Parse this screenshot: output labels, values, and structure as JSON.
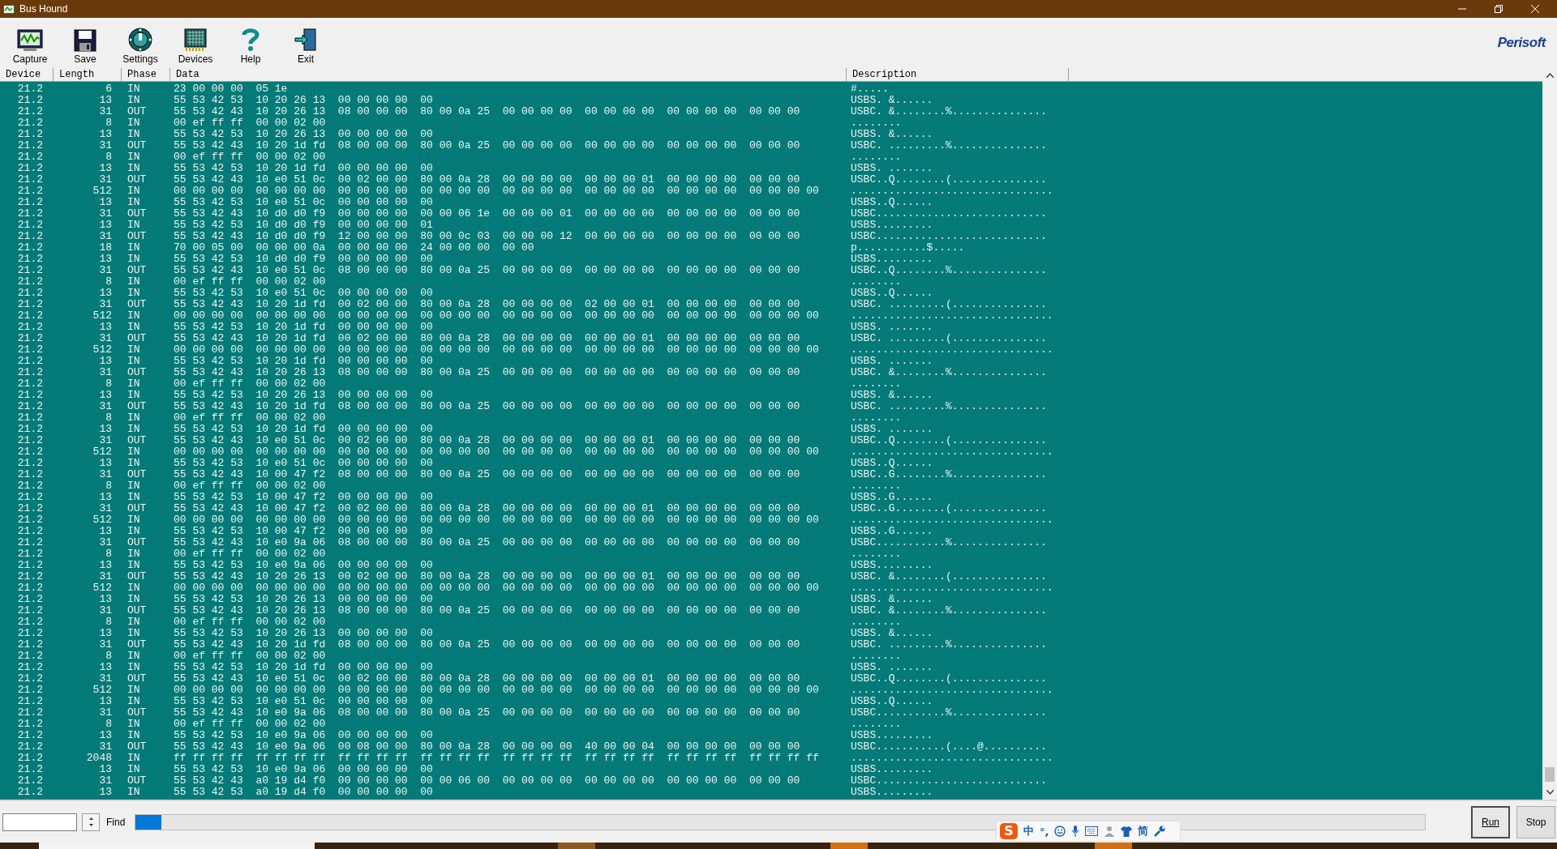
{
  "window": {
    "title": "Bus Hound"
  },
  "toolbar": {
    "buttons": [
      {
        "label": "Capture",
        "kind": "capture"
      },
      {
        "label": "Save",
        "kind": "save"
      },
      {
        "label": "Settings",
        "kind": "settings"
      },
      {
        "label": "Devices",
        "kind": "devices"
      },
      {
        "label": "Help",
        "kind": "help"
      },
      {
        "label": "Exit",
        "kind": "exit"
      }
    ],
    "logo": "Perisoft"
  },
  "columns": [
    "Device",
    "Length",
    "Phase",
    "Data",
    "Description"
  ],
  "rows": [
    {
      "device": "21.2",
      "length": "6",
      "phase": "IN",
      "data": "23 00 00 00  05 1e",
      "description": "#....."
    },
    {
      "device": "21.2",
      "length": "13",
      "phase": "IN",
      "data": "55 53 42 53  10 20 26 13  00 00 00 00  00",
      "description": "USBS. &......"
    },
    {
      "device": "21.2",
      "length": "31",
      "phase": "OUT",
      "data": "55 53 42 43  10 20 26 13  08 00 00 00  80 00 0a 25  00 00 00 00  00 00 00 00  00 00 00 00  00 00 00",
      "description": "USBC. &........%..............."
    },
    {
      "device": "21.2",
      "length": "8",
      "phase": "IN",
      "data": "00 ef ff ff  00 00 02 00",
      "description": "........"
    },
    {
      "device": "21.2",
      "length": "13",
      "phase": "IN",
      "data": "55 53 42 53  10 20 26 13  00 00 00 00  00",
      "description": "USBS. &......"
    },
    {
      "device": "21.2",
      "length": "31",
      "phase": "OUT",
      "data": "55 53 42 43  10 20 1d fd  08 00 00 00  80 00 0a 25  00 00 00 00  00 00 00 00  00 00 00 00  00 00 00",
      "description": "USBC. .........%..............."
    },
    {
      "device": "21.2",
      "length": "8",
      "phase": "IN",
      "data": "00 ef ff ff  00 00 02 00",
      "description": "........"
    },
    {
      "device": "21.2",
      "length": "13",
      "phase": "IN",
      "data": "55 53 42 53  10 20 1d fd  00 00 00 00  00",
      "description": "USBS. ......."
    },
    {
      "device": "21.2",
      "length": "31",
      "phase": "OUT",
      "data": "55 53 42 43  10 e0 51 0c  00 02 00 00  80 00 0a 28  00 00 00 00  00 00 00 01  00 00 00 00  00 00 00",
      "description": "USBC..Q........(..............."
    },
    {
      "device": "21.2",
      "length": "512",
      "phase": "IN",
      "data": "00 00 00 00  00 00 00 00  00 00 00 00  00 00 00 00  00 00 00 00  00 00 00 00  00 00 00 00  00 00 00 00",
      "description": "................................"
    },
    {
      "device": "21.2",
      "length": "13",
      "phase": "IN",
      "data": "55 53 42 53  10 e0 51 0c  00 00 00 00  00",
      "description": "USBS..Q......"
    },
    {
      "device": "21.2",
      "length": "31",
      "phase": "OUT",
      "data": "55 53 42 43  10 d0 d0 f9  00 00 00 00  00 00 06 1e  00 00 00 01  00 00 00 00  00 00 00 00  00 00 00",
      "description": "USBC..........................."
    },
    {
      "device": "21.2",
      "length": "13",
      "phase": "IN",
      "data": "55 53 42 53  10 d0 d0 f9  00 00 00 00  01",
      "description": "USBS........."
    },
    {
      "device": "21.2",
      "length": "31",
      "phase": "OUT",
      "data": "55 53 42 43  10 d0 d0 f9  12 00 00 00  80 00 0c 03  00 00 00 12  00 00 00 00  00 00 00 00  00 00 00",
      "description": "USBC..........................."
    },
    {
      "device": "21.2",
      "length": "18",
      "phase": "IN",
      "data": "70 00 05 00  00 00 00 0a  00 00 00 00  24 00 00 00  00 00",
      "description": "p...........$....."
    },
    {
      "device": "21.2",
      "length": "13",
      "phase": "IN",
      "data": "55 53 42 53  10 d0 d0 f9  00 00 00 00  00",
      "description": "USBS........."
    },
    {
      "device": "21.2",
      "length": "31",
      "phase": "OUT",
      "data": "55 53 42 43  10 e0 51 0c  08 00 00 00  80 00 0a 25  00 00 00 00  00 00 00 00  00 00 00 00  00 00 00",
      "description": "USBC..Q........%..............."
    },
    {
      "device": "21.2",
      "length": "8",
      "phase": "IN",
      "data": "00 ef ff ff  00 00 02 00",
      "description": "........"
    },
    {
      "device": "21.2",
      "length": "13",
      "phase": "IN",
      "data": "55 53 42 53  10 e0 51 0c  00 00 00 00  00",
      "description": "USBS..Q......"
    },
    {
      "device": "21.2",
      "length": "31",
      "phase": "OUT",
      "data": "55 53 42 43  10 20 1d fd  00 02 00 00  80 00 0a 28  00 00 00 00  02 00 00 01  00 00 00 00  00 00 00",
      "description": "USBC. .........(..............."
    },
    {
      "device": "21.2",
      "length": "512",
      "phase": "IN",
      "data": "00 00 00 00  00 00 00 00  00 00 00 00  00 00 00 00  00 00 00 00  00 00 00 00  00 00 00 00  00 00 00 00",
      "description": "................................"
    },
    {
      "device": "21.2",
      "length": "13",
      "phase": "IN",
      "data": "55 53 42 53  10 20 1d fd  00 00 00 00  00",
      "description": "USBS. ......."
    },
    {
      "device": "21.2",
      "length": "31",
      "phase": "OUT",
      "data": "55 53 42 43  10 20 1d fd  00 02 00 00  80 00 0a 28  00 00 00 00  00 00 00 01  00 00 00 00  00 00 00",
      "description": "USBC. .........(..............."
    },
    {
      "device": "21.2",
      "length": "512",
      "phase": "IN",
      "data": "00 00 00 00  00 00 00 00  00 00 00 00  00 00 00 00  00 00 00 00  00 00 00 00  00 00 00 00  00 00 00 00",
      "description": "................................"
    },
    {
      "device": "21.2",
      "length": "13",
      "phase": "IN",
      "data": "55 53 42 53  10 20 1d fd  00 00 00 00  00",
      "description": "USBS. ......."
    },
    {
      "device": "21.2",
      "length": "31",
      "phase": "OUT",
      "data": "55 53 42 43  10 20 26 13  08 00 00 00  80 00 0a 25  00 00 00 00  00 00 00 00  00 00 00 00  00 00 00",
      "description": "USBC. &........%..............."
    },
    {
      "device": "21.2",
      "length": "8",
      "phase": "IN",
      "data": "00 ef ff ff  00 00 02 00",
      "description": "........"
    },
    {
      "device": "21.2",
      "length": "13",
      "phase": "IN",
      "data": "55 53 42 53  10 20 26 13  00 00 00 00  00",
      "description": "USBS. &......"
    },
    {
      "device": "21.2",
      "length": "31",
      "phase": "OUT",
      "data": "55 53 42 43  10 20 1d fd  08 00 00 00  80 00 0a 25  00 00 00 00  00 00 00 00  00 00 00 00  00 00 00",
      "description": "USBC. .........%..............."
    },
    {
      "device": "21.2",
      "length": "8",
      "phase": "IN",
      "data": "00 ef ff ff  00 00 02 00",
      "description": "........"
    },
    {
      "device": "21.2",
      "length": "13",
      "phase": "IN",
      "data": "55 53 42 53  10 20 1d fd  00 00 00 00  00",
      "description": "USBS. ......."
    },
    {
      "device": "21.2",
      "length": "31",
      "phase": "OUT",
      "data": "55 53 42 43  10 e0 51 0c  00 02 00 00  80 00 0a 28  00 00 00 00  00 00 00 01  00 00 00 00  00 00 00",
      "description": "USBC..Q........(..............."
    },
    {
      "device": "21.2",
      "length": "512",
      "phase": "IN",
      "data": "00 00 00 00  00 00 00 00  00 00 00 00  00 00 00 00  00 00 00 00  00 00 00 00  00 00 00 00  00 00 00 00",
      "description": "................................"
    },
    {
      "device": "21.2",
      "length": "13",
      "phase": "IN",
      "data": "55 53 42 53  10 e0 51 0c  00 00 00 00  00",
      "description": "USBS..Q......"
    },
    {
      "device": "21.2",
      "length": "31",
      "phase": "OUT",
      "data": "55 53 42 43  10 00 47 f2  08 00 00 00  80 00 0a 25  00 00 00 00  00 00 00 00  00 00 00 00  00 00 00",
      "description": "USBC..G........%..............."
    },
    {
      "device": "21.2",
      "length": "8",
      "phase": "IN",
      "data": "00 ef ff ff  00 00 02 00",
      "description": "........"
    },
    {
      "device": "21.2",
      "length": "13",
      "phase": "IN",
      "data": "55 53 42 53  10 00 47 f2  00 00 00 00  00",
      "description": "USBS..G......"
    },
    {
      "device": "21.2",
      "length": "31",
      "phase": "OUT",
      "data": "55 53 42 43  10 00 47 f2  00 02 00 00  80 00 0a 28  00 00 00 00  00 00 00 01  00 00 00 00  00 00 00",
      "description": "USBC..G........(..............."
    },
    {
      "device": "21.2",
      "length": "512",
      "phase": "IN",
      "data": "00 00 00 00  00 00 00 00  00 00 00 00  00 00 00 00  00 00 00 00  00 00 00 00  00 00 00 00  00 00 00 00",
      "description": "................................"
    },
    {
      "device": "21.2",
      "length": "13",
      "phase": "IN",
      "data": "55 53 42 53  10 00 47 f2  00 00 00 00  00",
      "description": "USBS..G......"
    },
    {
      "device": "21.2",
      "length": "31",
      "phase": "OUT",
      "data": "55 53 42 43  10 e0 9a 06  08 00 00 00  80 00 0a 25  00 00 00 00  00 00 00 00  00 00 00 00  00 00 00",
      "description": "USBC...........%..............."
    },
    {
      "device": "21.2",
      "length": "8",
      "phase": "IN",
      "data": "00 ef ff ff  00 00 02 00",
      "description": "........"
    },
    {
      "device": "21.2",
      "length": "13",
      "phase": "IN",
      "data": "55 53 42 53  10 e0 9a 06  00 00 00 00  00",
      "description": "USBS........."
    },
    {
      "device": "21.2",
      "length": "31",
      "phase": "OUT",
      "data": "55 53 42 43  10 20 26 13  00 02 00 00  80 00 0a 28  00 00 00 00  00 00 00 01  00 00 00 00  00 00 00",
      "description": "USBC. &........(..............."
    },
    {
      "device": "21.2",
      "length": "512",
      "phase": "IN",
      "data": "00 00 00 00  00 00 00 00  00 00 00 00  00 00 00 00  00 00 00 00  00 00 00 00  00 00 00 00  00 00 00 00",
      "description": "................................"
    },
    {
      "device": "21.2",
      "length": "13",
      "phase": "IN",
      "data": "55 53 42 53  10 20 26 13  00 00 00 00  00",
      "description": "USBS. &......"
    },
    {
      "device": "21.2",
      "length": "31",
      "phase": "OUT",
      "data": "55 53 42 43  10 20 26 13  08 00 00 00  80 00 0a 25  00 00 00 00  00 00 00 00  00 00 00 00  00 00 00",
      "description": "USBC. &........%..............."
    },
    {
      "device": "21.2",
      "length": "8",
      "phase": "IN",
      "data": "00 ef ff ff  00 00 02 00",
      "description": "........"
    },
    {
      "device": "21.2",
      "length": "13",
      "phase": "IN",
      "data": "55 53 42 53  10 20 26 13  00 00 00 00  00",
      "description": "USBS. &......"
    },
    {
      "device": "21.2",
      "length": "31",
      "phase": "OUT",
      "data": "55 53 42 43  10 20 1d fd  08 00 00 00  80 00 0a 25  00 00 00 00  00 00 00 00  00 00 00 00  00 00 00",
      "description": "USBC. .........%..............."
    },
    {
      "device": "21.2",
      "length": "8",
      "phase": "IN",
      "data": "00 ef ff ff  00 00 02 00",
      "description": "........"
    },
    {
      "device": "21.2",
      "length": "13",
      "phase": "IN",
      "data": "55 53 42 53  10 20 1d fd  00 00 00 00  00",
      "description": "USBS. ......."
    },
    {
      "device": "21.2",
      "length": "31",
      "phase": "OUT",
      "data": "55 53 42 43  10 e0 51 0c  00 02 00 00  80 00 0a 28  00 00 00 00  00 00 00 01  00 00 00 00  00 00 00",
      "description": "USBC..Q........(..............."
    },
    {
      "device": "21.2",
      "length": "512",
      "phase": "IN",
      "data": "00 00 00 00  00 00 00 00  00 00 00 00  00 00 00 00  00 00 00 00  00 00 00 00  00 00 00 00  00 00 00 00",
      "description": "................................"
    },
    {
      "device": "21.2",
      "length": "13",
      "phase": "IN",
      "data": "55 53 42 53  10 e0 51 0c  00 00 00 00  00",
      "description": "USBS..Q......"
    },
    {
      "device": "21.2",
      "length": "31",
      "phase": "OUT",
      "data": "55 53 42 43  10 e0 9a 06  08 00 00 00  80 00 0a 25  00 00 00 00  00 00 00 00  00 00 00 00  00 00 00",
      "description": "USBC...........%..............."
    },
    {
      "device": "21.2",
      "length": "8",
      "phase": "IN",
      "data": "00 ef ff ff  00 00 02 00",
      "description": "........"
    },
    {
      "device": "21.2",
      "length": "13",
      "phase": "IN",
      "data": "55 53 42 53  10 e0 9a 06  00 00 00 00  00",
      "description": "USBS........."
    },
    {
      "device": "21.2",
      "length": "31",
      "phase": "OUT",
      "data": "55 53 42 43  10 e0 9a 06  00 08 00 00  80 00 0a 28  00 00 00 00  40 00 00 04  00 00 00 00  00 00 00",
      "description": "USBC...........(....@.........."
    },
    {
      "device": "21.2",
      "length": "2048",
      "phase": "IN",
      "data": "ff ff ff ff  ff ff ff ff  ff ff ff ff  ff ff ff ff  ff ff ff ff  ff ff ff ff  ff ff ff ff  ff ff ff ff",
      "description": "................................"
    },
    {
      "device": "21.2",
      "length": "13",
      "phase": "IN",
      "data": "55 53 42 53  10 e0 9a 06  00 00 00 00  00",
      "description": "USBS........."
    },
    {
      "device": "21.2",
      "length": "31",
      "phase": "OUT",
      "data": "55 53 42 43  a0 19 d4 f0  00 00 00 00  00 00 06 00  00 00 00 00  00 00 00 00  00 00 00 00  00 00 00",
      "description": "USBC..........................."
    },
    {
      "device": "21.2",
      "length": "13",
      "phase": "IN",
      "data": "55 53 42 53  a0 19 d4 f0  00 00 00 00  00",
      "description": "USBS........."
    }
  ],
  "find_bar": {
    "button": "Find",
    "progress": {
      "level": 0.02
    }
  },
  "run_buttons": [
    {
      "label": "Run",
      "pressed": true
    },
    {
      "label": "Stop",
      "pressed": false
    }
  ],
  "ime_toolbar": {
    "items": [
      {
        "kind": "badge",
        "label": "S"
      },
      {
        "kind": "text",
        "label": "中"
      },
      {
        "kind": "text",
        "label": "°,"
      },
      {
        "kind": "smiley"
      },
      {
        "kind": "mic"
      },
      {
        "kind": "keyboard"
      },
      {
        "kind": "person"
      },
      {
        "kind": "shirt"
      },
      {
        "kind": "text",
        "label": "简"
      },
      {
        "kind": "wrench"
      }
    ]
  }
}
